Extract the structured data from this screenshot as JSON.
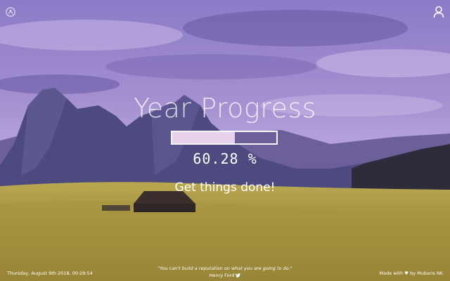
{
  "main": {
    "title": "Year Progress",
    "progress_fraction": 0.6028,
    "percent_text": "60.28 %",
    "motto": "Get things done!"
  },
  "footer": {
    "datetime": "Thursday, August 9th 2018, 00:29:54",
    "quote": "\"You can't build a reputation on what you are going to do.\"",
    "quote_author": "Henry Ford",
    "credit_prefix": "Made with",
    "credit_suffix": "by Mubaris NK"
  },
  "icons": {
    "top_left": "github-icon",
    "top_right": "user-icon",
    "heart": "heart-icon",
    "twitter": "twitter-icon"
  },
  "colors": {
    "bar_fill": "#e9d3ec",
    "overlay": "#7b64b8"
  }
}
